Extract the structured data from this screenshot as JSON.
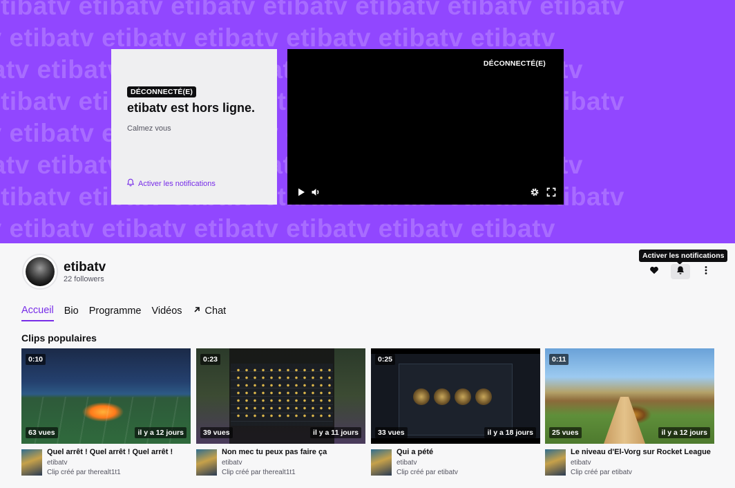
{
  "banner": {
    "pattern_text": "etibatv etibatv etibatv etibatv etibatv etibatv etibatv",
    "offline_badge": "DÉCONNECTÉ(E)",
    "offline_title": "etibatv est hors ligne.",
    "offline_description": "Calmez vous",
    "notifications_link": "Activer les notifications",
    "player_status": "DÉCONNECTÉ(E)",
    "colors": {
      "banner_bg": "#9147ff",
      "accent": "#772ce8"
    }
  },
  "channel": {
    "name": "etibatv",
    "followers": "22 followers",
    "tooltip": "Activer les notifications"
  },
  "tabs": [
    {
      "label": "Accueil"
    },
    {
      "label": "Bio"
    },
    {
      "label": "Programme"
    },
    {
      "label": "Vidéos"
    },
    {
      "label": "Chat"
    }
  ],
  "clips_section": {
    "title": "Clips populaires",
    "clips": [
      {
        "duration": "0:10",
        "views": "63 vues",
        "date": "il y a 12 jours",
        "title": "Quel arrêt ! Quel arrêt ! Quel arrêt !",
        "channel": "etibatv",
        "creator": "Clip créé par therealt1t1"
      },
      {
        "duration": "0:23",
        "views": "39 vues",
        "date": "il y a 11 jours",
        "title": "Non mec tu peux pas faire ça",
        "channel": "etibatv",
        "creator": "Clip créé par therealt1t1"
      },
      {
        "duration": "0:25",
        "views": "33 vues",
        "date": "il y a 18 jours",
        "title": "Qui a pété",
        "channel": "etibatv",
        "creator": "Clip créé par etibatv"
      },
      {
        "duration": "0:11",
        "views": "25 vues",
        "date": "il y a 12 jours",
        "title": "Le niveau d'El-Vorg sur Rocket League",
        "channel": "etibatv",
        "creator": "Clip créé par etibatv"
      }
    ]
  }
}
